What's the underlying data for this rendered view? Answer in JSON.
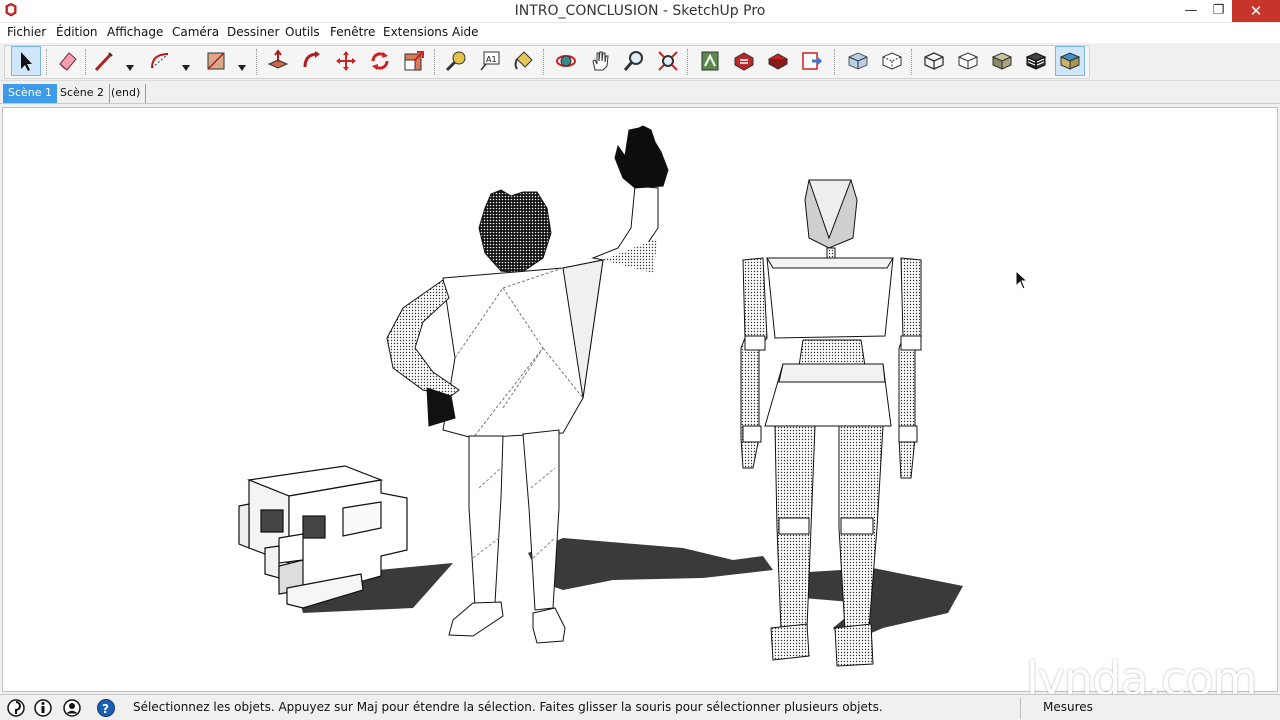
{
  "window": {
    "title": "INTRO_CONCLUSION - SketchUp Pro",
    "minimize_glyph": "—",
    "maximize_glyph": "❐",
    "close_glyph": "✕"
  },
  "menu": {
    "items": [
      "Fichier",
      "Édition",
      "Affichage",
      "Caméra",
      "Dessiner",
      "Outils",
      "Fenêtre",
      "Extensions",
      "Aide"
    ]
  },
  "toolbar": {
    "tools": [
      "select-icon",
      "eraser-icon",
      "line-icon",
      "arc-icon",
      "rectangle-icon",
      "push-pull-icon",
      "follow-me-icon",
      "move-icon",
      "rotate-icon",
      "scale-icon",
      "tape-measure-icon",
      "text-icon",
      "paint-bucket-icon",
      "orbit-icon",
      "pan-icon",
      "zoom-icon",
      "zoom-extents-icon",
      "3d-warehouse-icon",
      "extension-warehouse-icon",
      "layout-icon",
      "send-to-layout-icon",
      "xray-icon",
      "back-edges-icon",
      "wireframe-icon",
      "hidden-line-icon",
      "shaded-icon",
      "shaded-textures-icon",
      "monochrome-icon"
    ],
    "active_tool": "select-icon"
  },
  "scenes": {
    "tabs": [
      "Scène 1",
      "Scène 2",
      "(end)"
    ],
    "active_index": 0
  },
  "status": {
    "message": "Sélectionnez les objets. Appuyez sur Maj pour étendre la sélection. Faites glisser la souris pour sélectionner plusieurs objets.",
    "measurements_label": "Mesures",
    "icons": [
      "geo-location-icon",
      "credits-icon",
      "user-icon",
      "help-icon"
    ]
  },
  "watermark": {
    "text": "lynda.com"
  },
  "colors": {
    "active_tab": "#3d9be9",
    "close_button": "#c7352a",
    "viewport_bg": "#ffffff"
  }
}
